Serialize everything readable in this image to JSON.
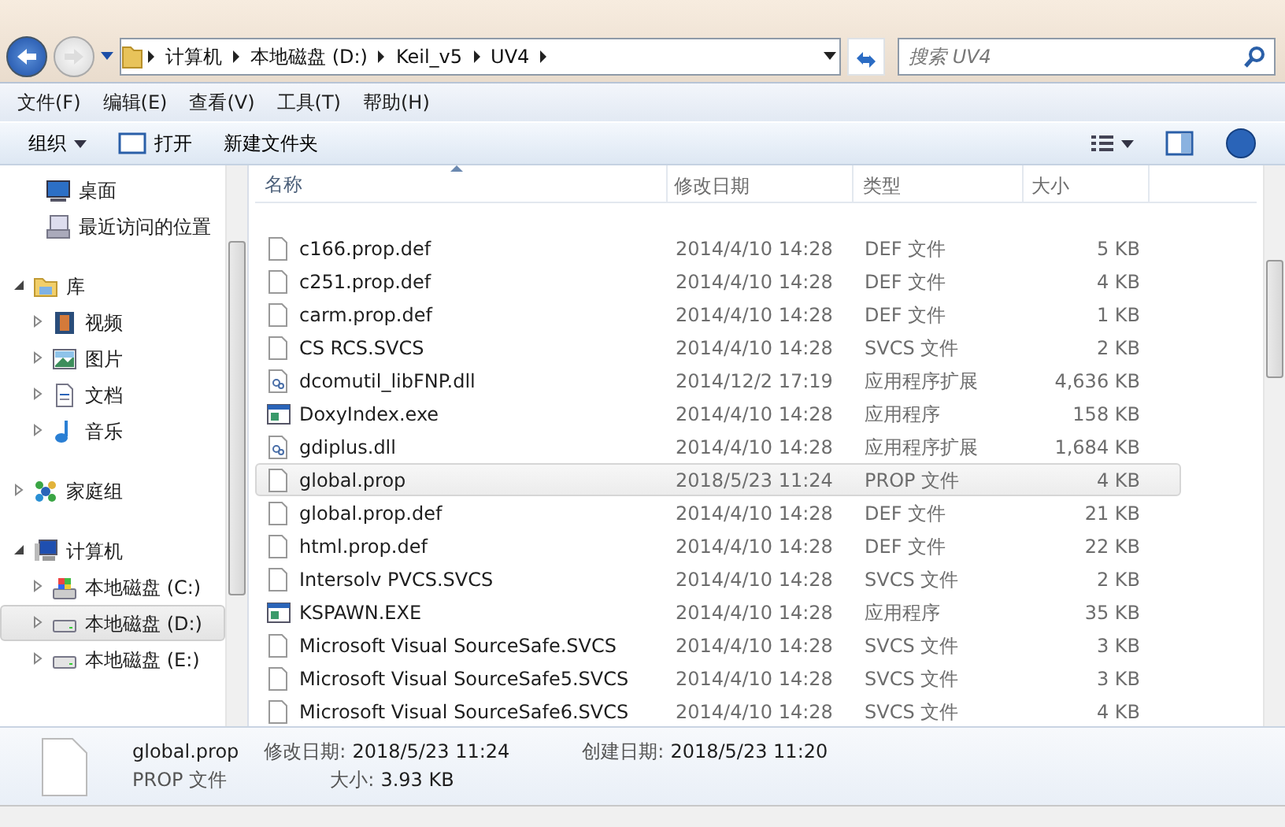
{
  "address_bar": {
    "segments": [
      "计算机",
      "本地磁盘 (D:)",
      "Keil_v5",
      "UV4"
    ]
  },
  "search": {
    "placeholder": "搜索 UV4"
  },
  "menu": [
    "文件(F)",
    "编辑(E)",
    "查看(V)",
    "工具(T)",
    "帮助(H)"
  ],
  "toolbar": {
    "buttons": [
      {
        "label": "组织",
        "kind": "dropdown"
      },
      {
        "label": "打开",
        "kind": "open"
      },
      {
        "label": "新建文件夹",
        "kind": "plain"
      }
    ]
  },
  "sidebar": {
    "sections": [
      {
        "items": [
          {
            "label": "桌面",
            "kind": "desktop",
            "selected": false
          },
          {
            "label": "最近访问的位置",
            "kind": "recent",
            "selected": false
          }
        ]
      },
      {
        "items": [
          {
            "label": "库",
            "kind": "library",
            "selected": false,
            "expanded": true,
            "children": [
              {
                "label": "视频",
                "kind": "video",
                "selected": false,
                "expanded": false
              },
              {
                "label": "图片",
                "kind": "picture",
                "selected": false,
                "expanded": false
              },
              {
                "label": "文档",
                "kind": "document",
                "selected": false,
                "expanded": false
              },
              {
                "label": "音乐",
                "kind": "music",
                "selected": false,
                "expanded": false
              }
            ]
          }
        ]
      },
      {
        "items": [
          {
            "label": "家庭组",
            "kind": "homegroup",
            "selected": false,
            "expanded": false
          }
        ]
      },
      {
        "items": [
          {
            "label": "计算机",
            "kind": "computer",
            "selected": false,
            "expanded": true,
            "children": [
              {
                "label": "本地磁盘 (C:)",
                "kind": "system-drive",
                "selected": false,
                "expanded": false
              },
              {
                "label": "本地磁盘 (D:)",
                "kind": "drive",
                "selected": true,
                "expanded": false
              },
              {
                "label": "本地磁盘 (E:)",
                "kind": "drive",
                "selected": false,
                "expanded": false
              }
            ]
          }
        ]
      }
    ]
  },
  "table": {
    "columns": [
      "名称",
      "修改日期",
      "类型",
      "大小"
    ],
    "rows": [
      {
        "name": "c166.prop.def",
        "date": "2014/4/10 14:28",
        "type": "DEF 文件",
        "size": "5 KB",
        "kind": "file",
        "selected": false
      },
      {
        "name": "c251.prop.def",
        "date": "2014/4/10 14:28",
        "type": "DEF 文件",
        "size": "4 KB",
        "kind": "file",
        "selected": false
      },
      {
        "name": "carm.prop.def",
        "date": "2014/4/10 14:28",
        "type": "DEF 文件",
        "size": "1 KB",
        "kind": "file",
        "selected": false
      },
      {
        "name": "CS RCS.SVCS",
        "date": "2014/4/10 14:28",
        "type": "SVCS 文件",
        "size": "2 KB",
        "kind": "file",
        "selected": false
      },
      {
        "name": "dcomutil_libFNP.dll",
        "date": "2014/12/2 17:19",
        "type": "应用程序扩展",
        "size": "4,636 KB",
        "kind": "dll",
        "selected": false
      },
      {
        "name": "DoxyIndex.exe",
        "date": "2014/4/10 14:28",
        "type": "应用程序",
        "size": "158 KB",
        "kind": "exe",
        "selected": false
      },
      {
        "name": "gdiplus.dll",
        "date": "2014/4/10 14:28",
        "type": "应用程序扩展",
        "size": "1,684 KB",
        "kind": "dll",
        "selected": false
      },
      {
        "name": "global.prop",
        "date": "2018/5/23 11:24",
        "type": "PROP 文件",
        "size": "4 KB",
        "kind": "file",
        "selected": true
      },
      {
        "name": "global.prop.def",
        "date": "2014/4/10 14:28",
        "type": "DEF 文件",
        "size": "21 KB",
        "kind": "file",
        "selected": false
      },
      {
        "name": "html.prop.def",
        "date": "2014/4/10 14:28",
        "type": "DEF 文件",
        "size": "22 KB",
        "kind": "file",
        "selected": false
      },
      {
        "name": "Intersolv PVCS.SVCS",
        "date": "2014/4/10 14:28",
        "type": "SVCS 文件",
        "size": "2 KB",
        "kind": "file",
        "selected": false
      },
      {
        "name": "KSPAWN.EXE",
        "date": "2014/4/10 14:28",
        "type": "应用程序",
        "size": "35 KB",
        "kind": "exe",
        "selected": false
      },
      {
        "name": "Microsoft Visual SourceSafe.SVCS",
        "date": "2014/4/10 14:28",
        "type": "SVCS 文件",
        "size": "3 KB",
        "kind": "file",
        "selected": false
      },
      {
        "name": "Microsoft Visual SourceSafe5.SVCS",
        "date": "2014/4/10 14:28",
        "type": "SVCS 文件",
        "size": "3 KB",
        "kind": "file",
        "selected": false
      },
      {
        "name": "Microsoft Visual SourceSafe6.SVCS",
        "date": "2014/4/10 14:28",
        "type": "SVCS 文件",
        "size": "4 KB",
        "kind": "file",
        "selected": false
      }
    ]
  },
  "details": {
    "name": "global.prop",
    "type": "PROP 文件",
    "fields": [
      {
        "label": "修改日期:",
        "value": "2018/5/23 11:24"
      },
      {
        "label": "大小:",
        "value": "3.93 KB"
      },
      {
        "label": "创建日期:",
        "value": "2018/5/23 11:20"
      }
    ]
  }
}
